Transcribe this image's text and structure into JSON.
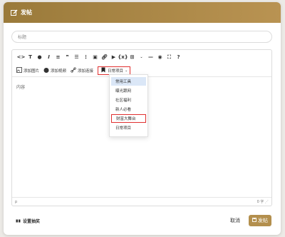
{
  "header": {
    "title": "发帖",
    "icon": "edit-icon"
  },
  "title_field": {
    "placeholder": "标题"
  },
  "toolbar": {
    "row1": [
      "code-icon",
      "text-color-icon",
      "drop-icon",
      "italic-icon",
      "align-icon",
      "quote-icon",
      "ordered-list-icon",
      "unordered-list-icon",
      "image-icon",
      "link-icon",
      "video-icon",
      "formula-icon",
      "table-icon",
      "hr-icon",
      "eye-icon",
      "fullscreen-icon",
      "help-icon"
    ],
    "add_image": "添加图片",
    "add_video": "添加视频",
    "add_link": "添加连接",
    "daily_project": "日常项目"
  },
  "editor": {
    "placeholder": "内容",
    "path": "p",
    "count": "0 字"
  },
  "dropdown": {
    "items": [
      {
        "label": "常用工具",
        "selected": true,
        "highlight": false
      },
      {
        "label": "曝光跟网",
        "selected": false,
        "highlight": false
      },
      {
        "label": "社区福利",
        "selected": false,
        "highlight": false
      },
      {
        "label": "新人必看",
        "selected": false,
        "highlight": false
      },
      {
        "label": "财富大舞台",
        "selected": false,
        "highlight": true
      },
      {
        "label": "日常项目",
        "selected": false,
        "highlight": false
      }
    ]
  },
  "footer": {
    "settings": "设置抽奖",
    "cancel": "取消",
    "post": "发帖"
  },
  "colors": {
    "accent": "#b38f4d",
    "highlight": "#e03030",
    "selected_bg": "#dbe7f7"
  }
}
